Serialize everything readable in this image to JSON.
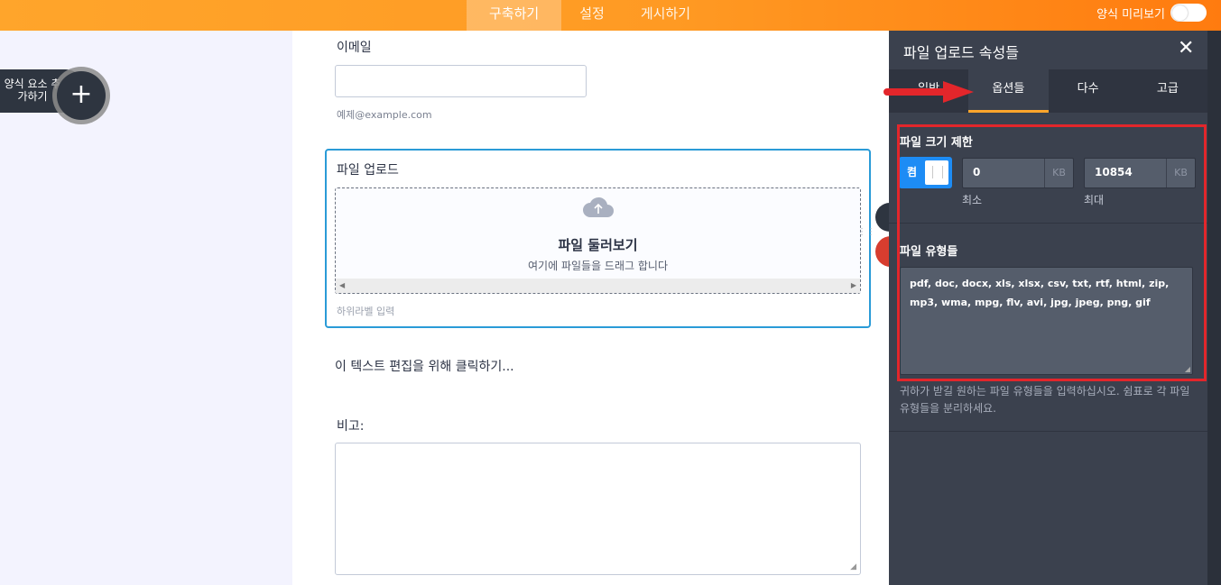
{
  "topbar": {
    "tabs": [
      {
        "label": "구축하기",
        "active": true
      },
      {
        "label": "설정",
        "active": false
      },
      {
        "label": "게시하기",
        "active": false
      }
    ],
    "preview_label": "양식 미리보기",
    "preview_toggle_on": false,
    "accent_color": "#ff9a23"
  },
  "sidebar": {
    "add_element_label": "양식 요소 추가하기",
    "add_icon": "plus-icon"
  },
  "form": {
    "email_label": "이메일",
    "email_value": "",
    "email_sublabel": "예제@example.com",
    "upload_label": "파일 업로드",
    "upload_icon": "cloud-upload-icon",
    "upload_title": "파일 둘러보기",
    "upload_subtitle": "여기에 파일들을 드래그 합니다",
    "upload_sublabel": "하위라벨 입력",
    "text_block": "이 텍스트 편집을 위해 클릭하기...",
    "notes_label": "비고:",
    "notes_value": ""
  },
  "panel": {
    "title": "파일 업로드 속성들",
    "close_icon": "close-icon",
    "tabs": [
      {
        "label": "일반",
        "active": false
      },
      {
        "label": "옵션들",
        "active": true
      },
      {
        "label": "다수",
        "active": false
      },
      {
        "label": "고급",
        "active": false
      }
    ],
    "size_limit": {
      "title": "파일 크기 제한",
      "switch_label": "켬",
      "switch_on": true,
      "min_value": "0",
      "min_unit": "KB",
      "min_label": "최소",
      "max_value": "10854",
      "max_unit": "KB",
      "max_label": "최대"
    },
    "file_types": {
      "title": "파일 유형들",
      "value": "pdf, doc, docx, xls, xlsx, csv, txt, rtf, html, zip, mp3, wma, mpg, flv, avi, jpg, jpeg, png, gif",
      "help": "귀하가 받길 원하는 파일 유형들을 입력하십시오. 쉼표로 각 파일 유형들을 분리하세요."
    },
    "highlight_color": "#e3262b",
    "arrow_icon": "red-arrow-icon"
  }
}
